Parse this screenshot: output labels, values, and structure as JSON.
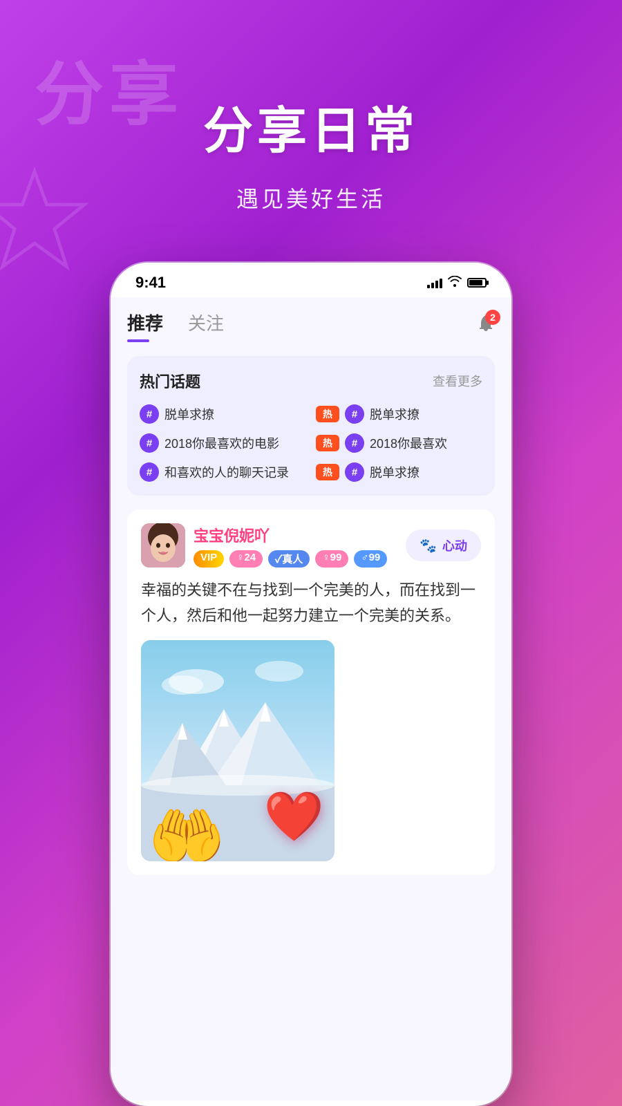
{
  "background": {
    "gradient": "linear-gradient(135deg, #c040e8 0%, #a020d0 30%, #d040c8 60%, #e060a0 100%)"
  },
  "hero": {
    "watermark": "分享",
    "title": "分享日常",
    "subtitle": "遇见美好生活"
  },
  "status_bar": {
    "time": "9:41",
    "signal": "signal-icon",
    "wifi": "wifi-icon",
    "battery": "battery-icon"
  },
  "nav": {
    "tab_recommended": "推荐",
    "tab_following": "关注",
    "bell_badge": "2"
  },
  "hot_topics": {
    "title": "热门话题",
    "see_more": "查看更多",
    "items": [
      {
        "text": "脱单求撩",
        "hot": false
      },
      {
        "text": "脱单求撩",
        "hot": true
      },
      {
        "text": "2018你最喜欢的电影",
        "hot": false
      },
      {
        "text": "2018你最喜欢",
        "hot": true
      },
      {
        "text": "和喜欢的人的聊天记录",
        "hot": false
      },
      {
        "text": "脱单求撩",
        "hot": true
      }
    ]
  },
  "post": {
    "username": "宝宝倪妮吖",
    "badge_vip": "VIP",
    "badge_female_age": "♀24",
    "badge_real": "✓真人",
    "badge_female99": "♀99",
    "badge_male99": "♂99",
    "heart_button": "心动",
    "text": "幸福的关键不在与找到一个完美的人，而在找到一个人，然后和他一起努力建立一个完美的关系。",
    "image_alt": "holding heart image"
  }
}
